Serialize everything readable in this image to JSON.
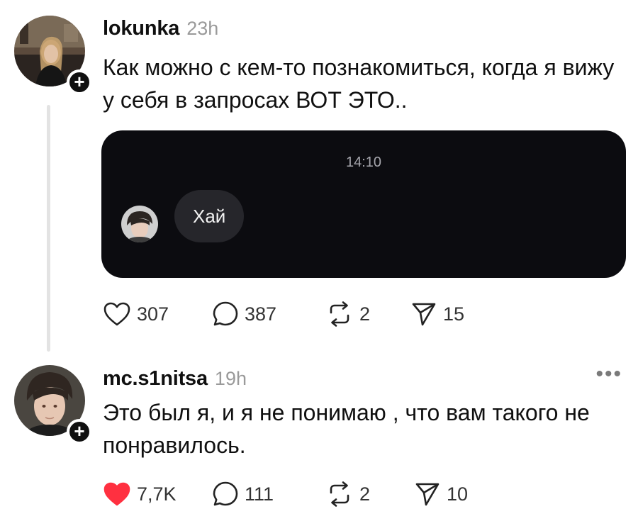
{
  "posts": [
    {
      "username": "lokunka",
      "time": "23h",
      "text": "Как можно с кем-то познакомиться, когда я вижу у себя в запросах ВОТ ЭТО..",
      "chat_preview": {
        "time": "14:10",
        "message": "Хай"
      },
      "actions": {
        "likes": "307",
        "comments": "387",
        "reposts": "2",
        "shares": "15",
        "liked": false
      }
    },
    {
      "username": "mc.s1nitsa",
      "time": "19h",
      "text": "Это был я, и я не понимаю , что вам такого не понравилось.",
      "actions": {
        "likes": "7,7K",
        "comments": "111",
        "reposts": "2",
        "shares": "10",
        "liked": true
      }
    }
  ],
  "colors": {
    "like_active": "#ff3040",
    "chat_background": "#0c0c10",
    "bubble_background": "#26262b"
  },
  "icons": [
    "heart-icon",
    "comment-icon",
    "repost-icon",
    "share-icon",
    "more-icon",
    "plus-icon"
  ]
}
